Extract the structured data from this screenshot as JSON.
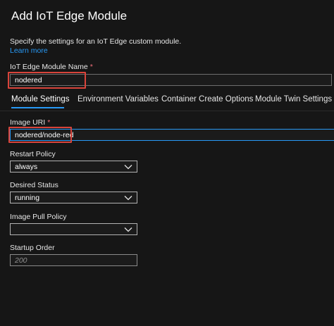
{
  "header": {
    "title": "Add IoT Edge Module",
    "description": "Specify the settings for an IoT Edge custom module.",
    "learn_more": "Learn more"
  },
  "module_name": {
    "label": "IoT Edge Module Name",
    "required_mark": "*",
    "value": "nodered"
  },
  "tabs": [
    {
      "label": "Module Settings",
      "active": true
    },
    {
      "label": "Environment Variables",
      "active": false
    },
    {
      "label": "Container Create Options",
      "active": false
    },
    {
      "label": "Module Twin Settings",
      "active": false
    }
  ],
  "image_uri": {
    "label": "Image URI",
    "required_mark": "*",
    "value": "nodered/node-red"
  },
  "restart_policy": {
    "label": "Restart Policy",
    "value": "always"
  },
  "desired_status": {
    "label": "Desired Status",
    "value": "running"
  },
  "image_pull_policy": {
    "label": "Image Pull Policy",
    "value": ""
  },
  "startup_order": {
    "label": "Startup Order",
    "placeholder": "200"
  },
  "colors": {
    "background": "#161616",
    "accent": "#2899f5",
    "highlight": "#d9443b",
    "required": "#f1707b"
  },
  "icons": {
    "dropdown": "chevron-down-icon"
  }
}
